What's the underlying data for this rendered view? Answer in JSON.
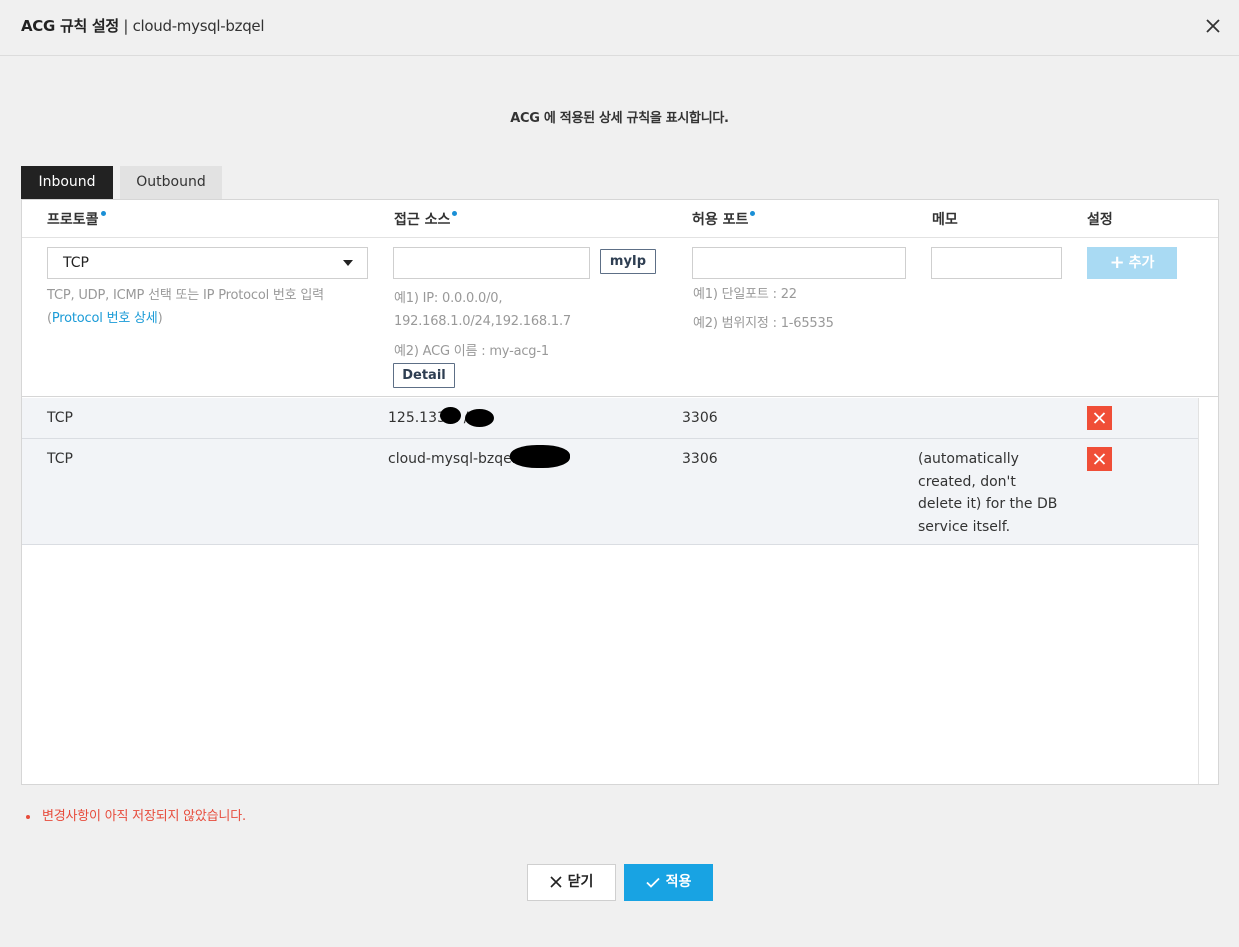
{
  "header": {
    "title_bold": "ACG 규칙 설정",
    "title_sep": " | ",
    "title_rest": "cloud-mysql-bzqel"
  },
  "description": "ACG 에 적용된 상세 규칙을 표시합니다.",
  "tabs": [
    {
      "label": "Inbound",
      "active": true
    },
    {
      "label": "Outbound",
      "active": false
    }
  ],
  "columns": {
    "protocol": "프로토콜",
    "source": "접근 소스",
    "port": "허용 포트",
    "memo": "메모",
    "setting": "설정"
  },
  "form": {
    "protocol_value": "TCP",
    "protocol_hint": "TCP, UDP, ICMP 선택 또는 IP Protocol 번호 입력",
    "protocol_hint_open": "(",
    "protocol_link": "Protocol 번호 상세",
    "protocol_hint_close": ")",
    "myip_label": "myIp",
    "source_hint1_line1": "예1) IP: 0.0.0.0/0,",
    "source_hint1_line2": "192.168.1.0/24,192.168.1.7",
    "source_hint2": "예2) ACG 이름 : my-acg-1",
    "detail_label": "Detail",
    "port_hint1": "예1) 단일포트 : 22",
    "port_hint2": "예2) 범위지정 : 1-65535",
    "add_label": "추가"
  },
  "rules": [
    {
      "protocol": "TCP",
      "source": "125.133.   .   /32",
      "port": "3306",
      "memo": ""
    },
    {
      "protocol": "TCP",
      "source": "cloud-mysql-bzqel(",
      "port": "3306",
      "memo": "(automatically created, don't delete it) for the DB service itself."
    }
  ],
  "warning": "변경사항이 아직 저장되지 않았습니다.",
  "footer": {
    "close_label": "닫기",
    "apply_label": "적용"
  },
  "colors": {
    "accent": "#18a3e3",
    "danger": "#f04e37",
    "warning_text": "#e74c3c",
    "link": "#1a9bd7",
    "req_dot": "#1a8fd6"
  },
  "icons": [
    "close-icon",
    "dropdown-arrow-icon",
    "plus-icon",
    "delete-x-icon",
    "check-icon"
  ]
}
